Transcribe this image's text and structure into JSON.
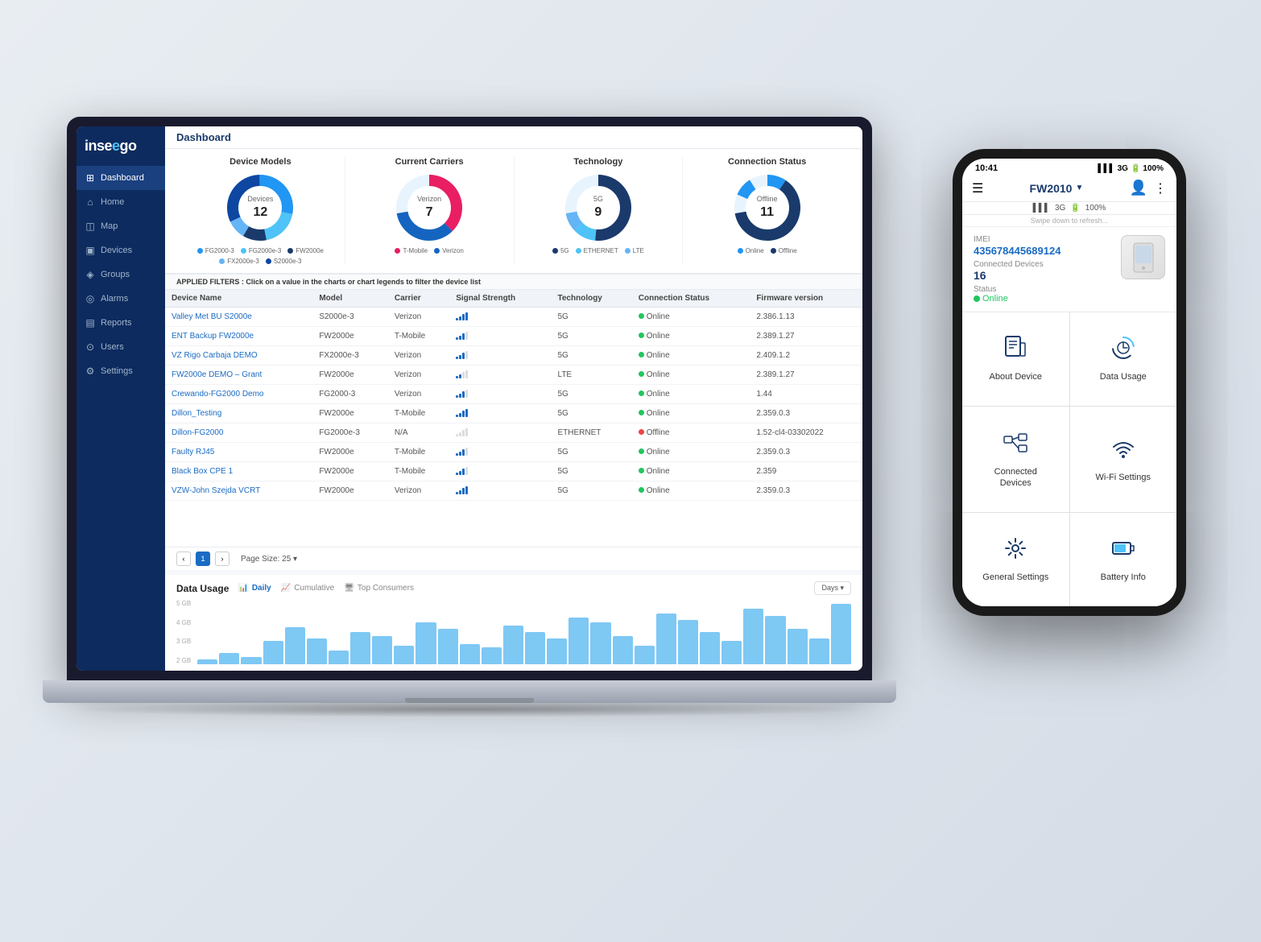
{
  "app": {
    "name": "inseego"
  },
  "sidebar": {
    "items": [
      {
        "label": "Dashboard",
        "icon": "⊞",
        "active": true
      },
      {
        "label": "Home",
        "icon": "⌂",
        "active": false
      },
      {
        "label": "Map",
        "icon": "◫",
        "active": false
      },
      {
        "label": "Devices",
        "icon": "▣",
        "active": false
      },
      {
        "label": "Groups",
        "icon": "◈",
        "active": false
      },
      {
        "label": "Alarms",
        "icon": "◎",
        "active": false
      },
      {
        "label": "Reports",
        "icon": "▤",
        "active": false
      },
      {
        "label": "Users",
        "icon": "⊙",
        "active": false
      },
      {
        "label": "Settings",
        "icon": "⚙",
        "active": false
      }
    ]
  },
  "charts": {
    "device_models": {
      "title": "Device Models",
      "center_label": "Devices",
      "center_value": "12",
      "legend": [
        {
          "label": "FG2000-3",
          "color": "#2196F3"
        },
        {
          "label": "FG2000e-3",
          "color": "#4FC3F7"
        },
        {
          "label": "FW2000e",
          "color": "#1a3a6b"
        },
        {
          "label": "FX2000e-3",
          "color": "#64B5F6"
        },
        {
          "label": "S2000e-3",
          "color": "#0D47A1"
        }
      ]
    },
    "current_carriers": {
      "title": "Current Carriers",
      "center_label": "Verizon",
      "center_value": "7",
      "legend": [
        {
          "label": "T-Mobile",
          "color": "#E91E63"
        },
        {
          "label": "Verizon",
          "color": "#1565C0"
        }
      ]
    },
    "technology": {
      "title": "Technology",
      "center_label": "5G",
      "center_value": "9",
      "legend": [
        {
          "label": "5G",
          "color": "#1a3a6b"
        },
        {
          "label": "ETHERNET",
          "color": "#4FC3F7"
        },
        {
          "label": "LTE",
          "color": "#64B5F6"
        }
      ]
    },
    "connection_status": {
      "title": "Connection Status",
      "center_label": "Offline",
      "center_value": "11",
      "legend": [
        {
          "label": "Online",
          "color": "#2196F3"
        },
        {
          "label": "Offline",
          "color": "#1a3a6b"
        }
      ]
    }
  },
  "filters_bar": {
    "text": "APPLIED FILTERS :",
    "hint": " Click on a value in the charts or chart legends to filter the device list"
  },
  "table": {
    "headers": [
      "Device Name",
      "Model",
      "Carrier",
      "Signal Strength",
      "Technology",
      "Connection Status",
      "Firmware version"
    ],
    "rows": [
      {
        "name": "Valley Met BU S2000e",
        "model": "S2000e-3",
        "carrier": "Verizon",
        "signal": 4,
        "tech": "5G",
        "status": "Online",
        "firmware": "2.386.1.13"
      },
      {
        "name": "ENT Backup FW2000e",
        "model": "FW2000e",
        "carrier": "T-Mobile",
        "signal": 3,
        "tech": "5G",
        "status": "Online",
        "firmware": "2.389.1.27"
      },
      {
        "name": "VZ Rigo Carbaja DEMO",
        "model": "FX2000e-3",
        "carrier": "Verizon",
        "signal": 3,
        "tech": "5G",
        "status": "Online",
        "firmware": "2.409.1.2"
      },
      {
        "name": "FW2000e DEMO – Grant",
        "model": "FW2000e",
        "carrier": "Verizon",
        "signal": 2,
        "tech": "LTE",
        "status": "Online",
        "firmware": "2.389.1.27"
      },
      {
        "name": "Crewando-FG2000 Demo",
        "model": "FG2000-3",
        "carrier": "Verizon",
        "signal": 3,
        "tech": "5G",
        "status": "Online",
        "firmware": "1.44"
      },
      {
        "name": "Dillon_Testing",
        "model": "FW2000e",
        "carrier": "T-Mobile",
        "signal": 4,
        "tech": "5G",
        "status": "Online",
        "firmware": "2.359.0.3"
      },
      {
        "name": "Dillon-FG2000",
        "model": "FG2000e-3",
        "carrier": "N/A",
        "signal": 0,
        "tech": "ETHERNET",
        "status": "Offline",
        "firmware": "1.52-cl4-03302022"
      },
      {
        "name": "Faulty RJ45",
        "model": "FW2000e",
        "carrier": "T-Mobile",
        "signal": 3,
        "tech": "5G",
        "status": "Online",
        "firmware": "2.359.0.3"
      },
      {
        "name": "Black Box CPE 1",
        "model": "FW2000e",
        "carrier": "T-Mobile",
        "signal": 3,
        "tech": "5G",
        "status": "Online",
        "firmware": "2.359"
      },
      {
        "name": "VZW-John Szejda VCRT",
        "model": "FW2000e",
        "carrier": "Verizon",
        "signal": 4,
        "tech": "5G",
        "status": "Online",
        "firmware": "2.359.0.3"
      }
    ]
  },
  "pagination": {
    "current": 1,
    "page_size_label": "Page Size: 25"
  },
  "data_usage": {
    "title": "Data Usage",
    "tabs": [
      {
        "label": "Daily",
        "active": true
      },
      {
        "label": "Cumulative",
        "active": false
      },
      {
        "label": "Top Consumers",
        "active": false
      }
    ],
    "days_btn": "Days ▾",
    "y_axis": [
      "5 GB",
      "4 GB",
      "3 GB",
      "2 GB"
    ],
    "bars": [
      5,
      12,
      8,
      25,
      40,
      28,
      15,
      35,
      30,
      20,
      45,
      38,
      22,
      18,
      42,
      35,
      28,
      50,
      45,
      30,
      20,
      55,
      48,
      35,
      25,
      60,
      52,
      38,
      28,
      65
    ]
  },
  "phone": {
    "time": "10:41",
    "device_name": "FW2010",
    "battery": "100%",
    "network": "3G",
    "swipe_hint": "Swipe down to refresh...",
    "imei_label": "IMEI",
    "imei_value": "435678445689124",
    "connected_label": "Connected Devices",
    "connected_value": "16",
    "status_label": "Status",
    "status_value": "Online",
    "menu_items": [
      {
        "label": "About Device",
        "icon": "about"
      },
      {
        "label": "Data Usage",
        "icon": "data"
      },
      {
        "label": "Connected\nDevices",
        "icon": "connected"
      },
      {
        "label": "Wi-Fi Settings",
        "icon": "wifi"
      },
      {
        "label": "General Settings",
        "icon": "settings"
      },
      {
        "label": "Battery Info",
        "icon": "battery"
      }
    ]
  }
}
